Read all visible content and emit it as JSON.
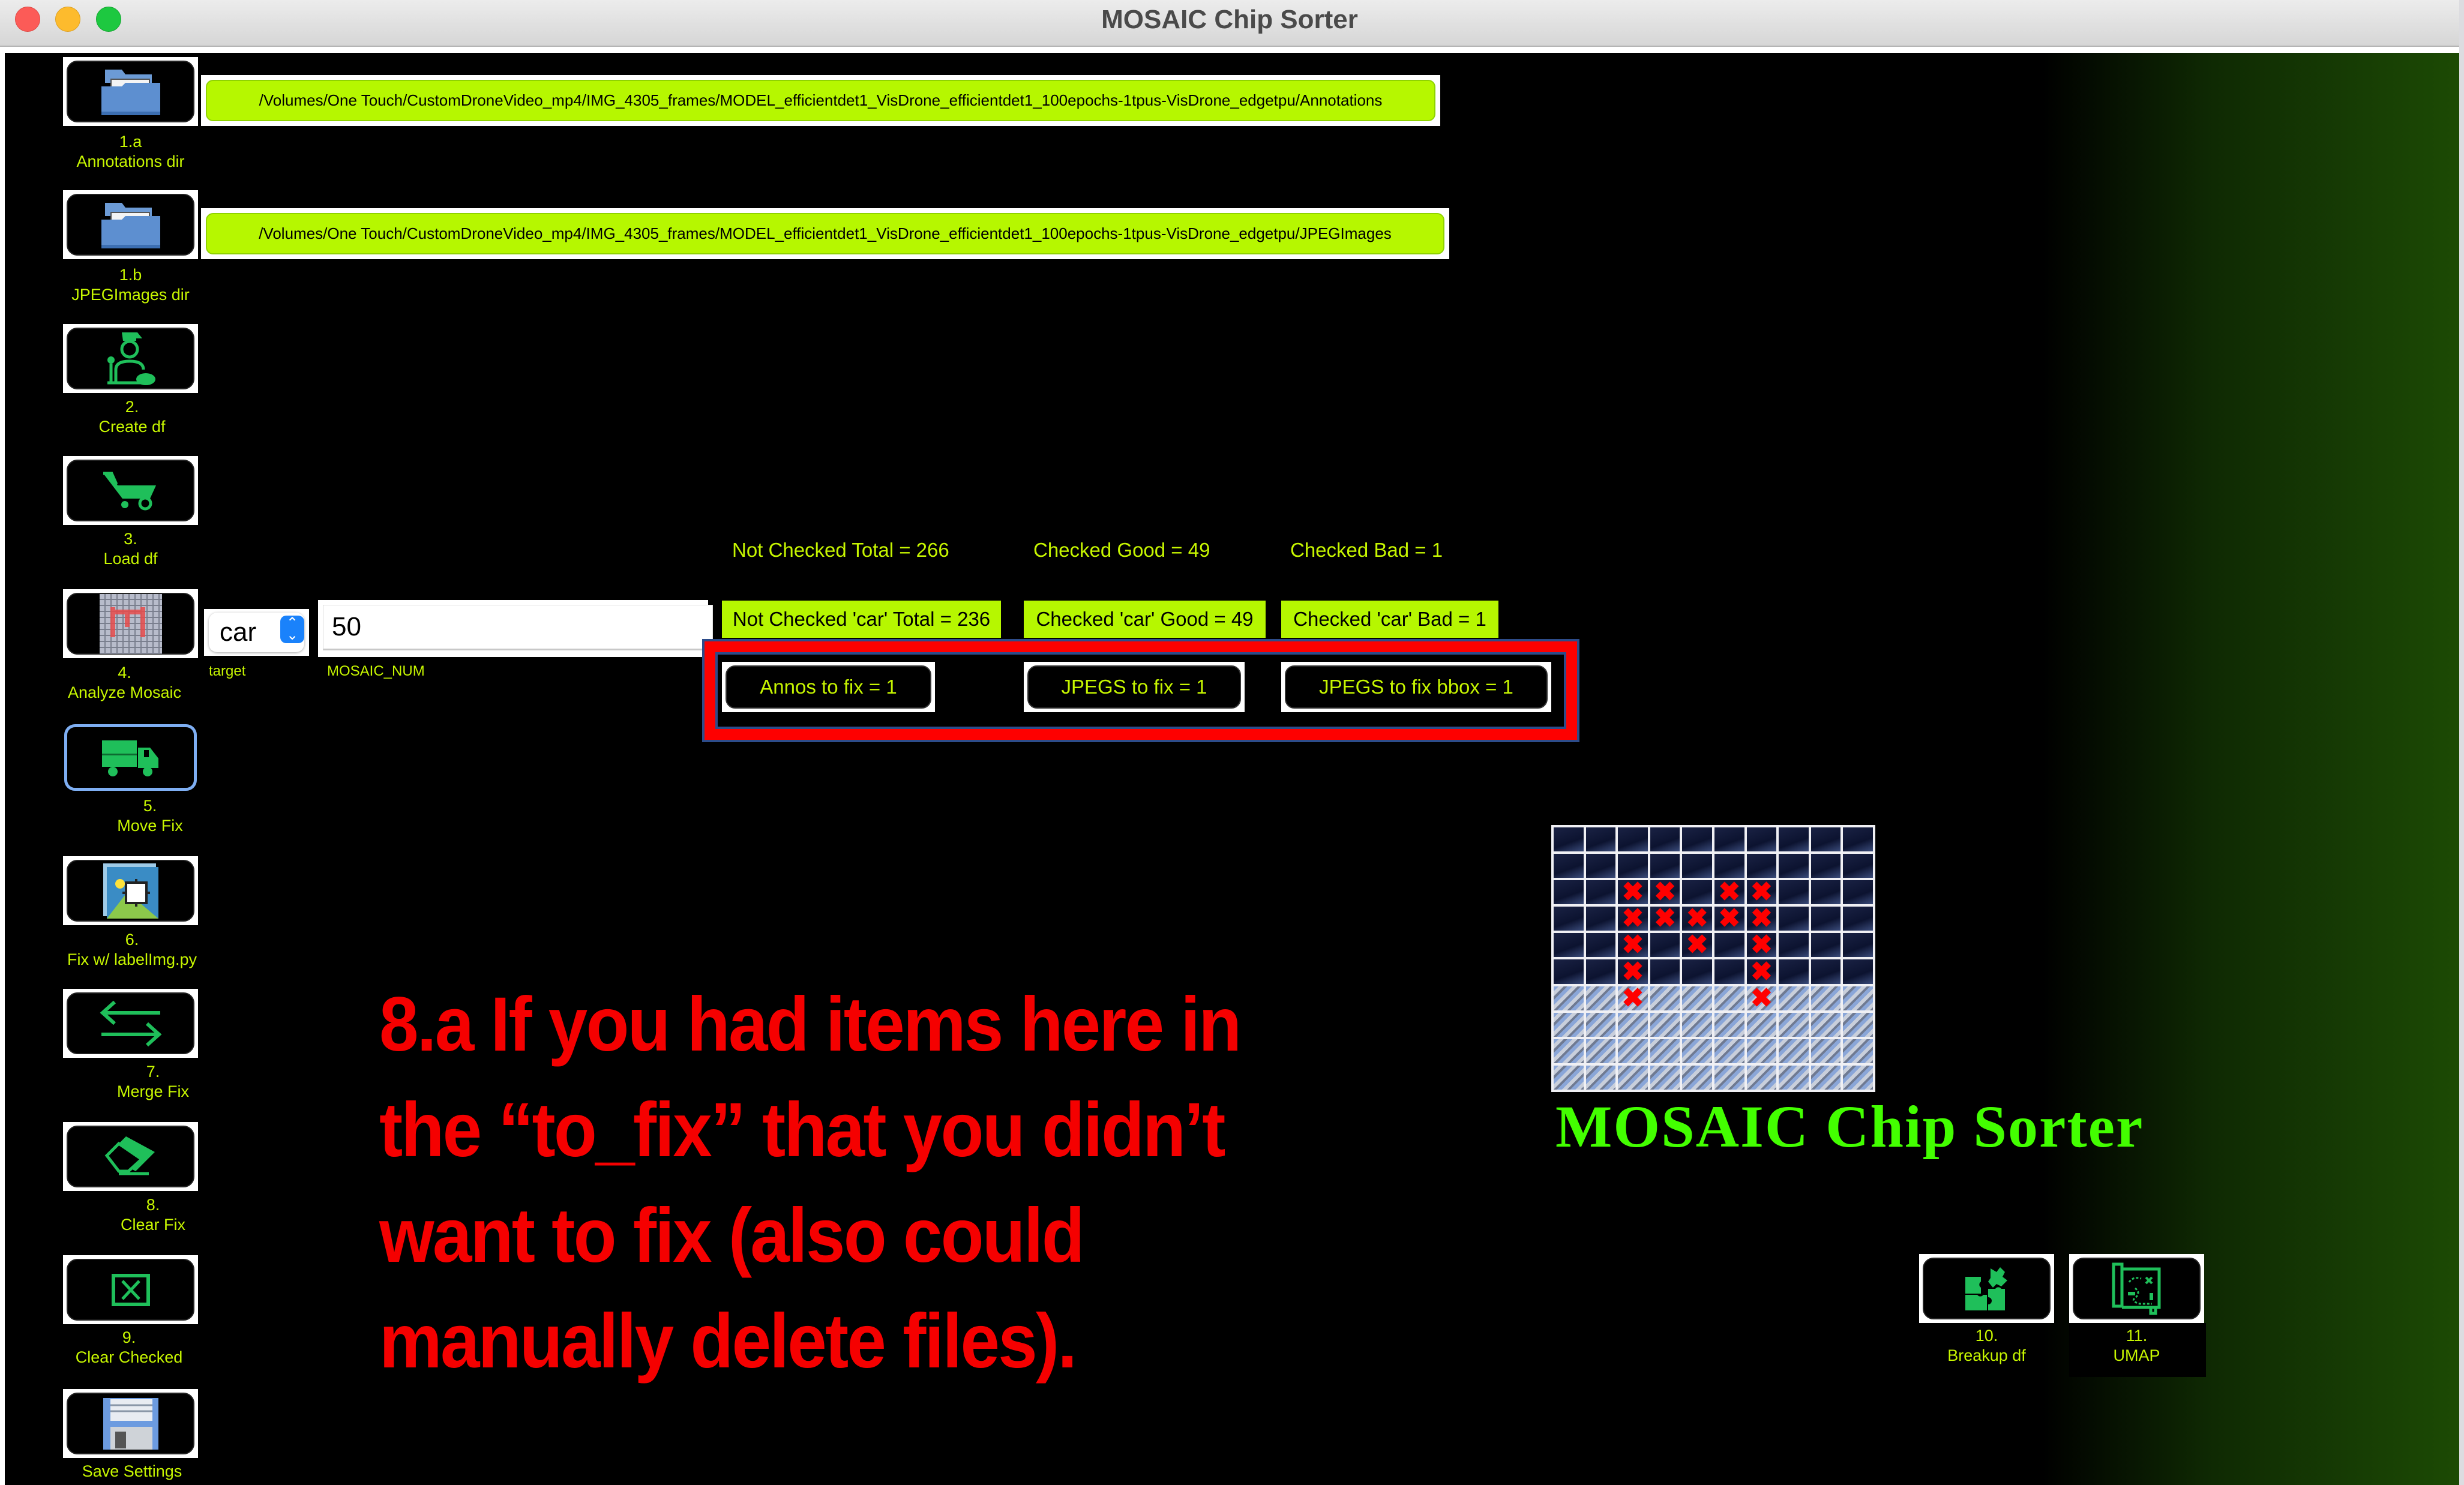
{
  "window": {
    "title": "MOSAIC Chip Sorter",
    "controls": [
      "close",
      "minimize",
      "maximize"
    ]
  },
  "sidebar": {
    "buttons": [
      {
        "step": "1.a",
        "label": "Annotations dir",
        "icon": "folder-open-icon"
      },
      {
        "step": "1.b",
        "label": "JPEGImages dir",
        "icon": "folder-open-icon"
      },
      {
        "step": "2.",
        "label": "Create df",
        "icon": "gardener-person-icon"
      },
      {
        "step": "3.",
        "label": "Load df",
        "icon": "wheelbarrow-icon"
      },
      {
        "step": "4.",
        "label": "Analyze Mosaic",
        "icon": "mosaic-thumbnail-icon"
      },
      {
        "step": "5.",
        "label": "Move Fix",
        "icon": "truck-icon"
      },
      {
        "step": "6.",
        "label": "Fix w/ labelImg.py",
        "icon": "labelimg-icon"
      },
      {
        "step": "7.",
        "label": "Merge Fix",
        "icon": "swap-arrows-icon"
      },
      {
        "step": "8.",
        "label": "Clear Fix",
        "icon": "eraser-icon"
      },
      {
        "step": "9.",
        "label": "Clear Checked",
        "icon": "close-box-icon"
      },
      {
        "step": "",
        "label": "Save Settings",
        "icon": "floppy-disk-icon"
      }
    ]
  },
  "paths": {
    "annotations": "/Volumes/One Touch/CustomDroneVideo_mp4/IMG_4305_frames/MODEL_efficientdet1_VisDrone_efficientdet1_100epochs-1tpus-VisDrone_edgetpu/Annotations",
    "jpegimages": "/Volumes/One Touch/CustomDroneVideo_mp4/IMG_4305_frames/MODEL_efficientdet1_VisDrone_efficientdet1_100epochs-1tpus-VisDrone_edgetpu/JPEGImages"
  },
  "controls": {
    "target": {
      "value": "car",
      "label": "target"
    },
    "mosaic_num": {
      "value": "50",
      "label": "MOSAIC_NUM"
    }
  },
  "stats": {
    "not_checked_total": "Not Checked Total = 266",
    "checked_good": "Checked Good = 49",
    "checked_bad": "Checked Bad = 1",
    "not_checked_target_total": "Not Checked 'car' Total = 236",
    "checked_target_good": "Checked 'car' Good = 49",
    "checked_target_bad": "Checked 'car' Bad = 1"
  },
  "fix_buttons": {
    "annos_to_fix": "Annos to fix = 1",
    "jpegs_to_fix": "JPEGS to fix = 1",
    "jpegs_to_fix_bbox": "JPEGS to fix bbox = 1"
  },
  "annotation_note": {
    "lines": [
      "8.a  If you had items here in",
      "the “to_fix” that you didn’t",
      "want to fix (also could",
      "manually delete files)."
    ],
    "color": "#f50000"
  },
  "logo": {
    "text": "MOSAIC Chip Sorter",
    "grid_cols": 10,
    "grid_rows": 10,
    "marked_cells": [
      [
        2,
        2
      ],
      [
        2,
        3
      ],
      [
        2,
        5
      ],
      [
        2,
        6
      ],
      [
        3,
        2
      ],
      [
        3,
        3
      ],
      [
        3,
        4
      ],
      [
        3,
        5
      ],
      [
        3,
        6
      ],
      [
        4,
        2
      ],
      [
        4,
        4
      ],
      [
        4,
        6
      ],
      [
        5,
        2
      ],
      [
        5,
        6
      ],
      [
        6,
        2
      ],
      [
        6,
        6
      ]
    ],
    "light_rows_from": 6
  },
  "bottom_buttons": [
    {
      "step": "10.",
      "label": "Breakup df",
      "icon": "puzzle-icon"
    },
    {
      "step": "11.",
      "label": "UMAP",
      "icon": "treasure-map-icon"
    }
  ],
  "colors": {
    "label_text": "#c6f500",
    "path_fill": "#b6f700",
    "icon_green": "#1fbf5a",
    "highlight_red": "#fe0000",
    "brand_green": "#43ff00"
  }
}
